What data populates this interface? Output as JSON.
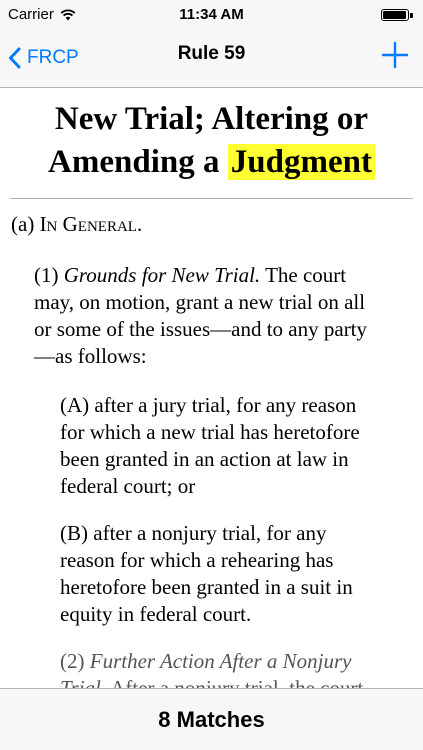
{
  "status_bar": {
    "carrier": "Carrier",
    "time": "11:34 AM",
    "battery_level": 0.95
  },
  "nav": {
    "back_label": "FRCP",
    "title": "Rule 59",
    "accent_color": "#007aff"
  },
  "rule": {
    "heading_lines": [
      "New Trial; Altering or",
      "Amending a"
    ],
    "highlighted_term": "Judgment",
    "highlight_color": "#ffff33"
  },
  "paragraphs": {
    "a": {
      "marker": "(a)",
      "heading": "In General."
    },
    "p1": {
      "marker": "(1)",
      "italic": "Grounds for New Trial.",
      "text": "The court may, on motion, grant a new trial on all or some of the issues—and to any party—as follows:"
    },
    "pA": {
      "marker": "(A)",
      "text": "after a jury trial, for any reason for which a new trial has heretofore been granted in an action at law in federal court; or"
    },
    "pB": {
      "marker": "(B)",
      "text": "after a nonjury trial, for any reason for which a rehearing has heretofore been granted in a suit in equity in federal court."
    },
    "p2": {
      "marker": "(2)",
      "italic": "Further Action After a Nonjury Trial.",
      "text": "After a nonjury trial, the court may, on motion for a new trial, open the judgment if one has been entered"
    }
  },
  "search": {
    "matches_label": "8 Matches"
  }
}
